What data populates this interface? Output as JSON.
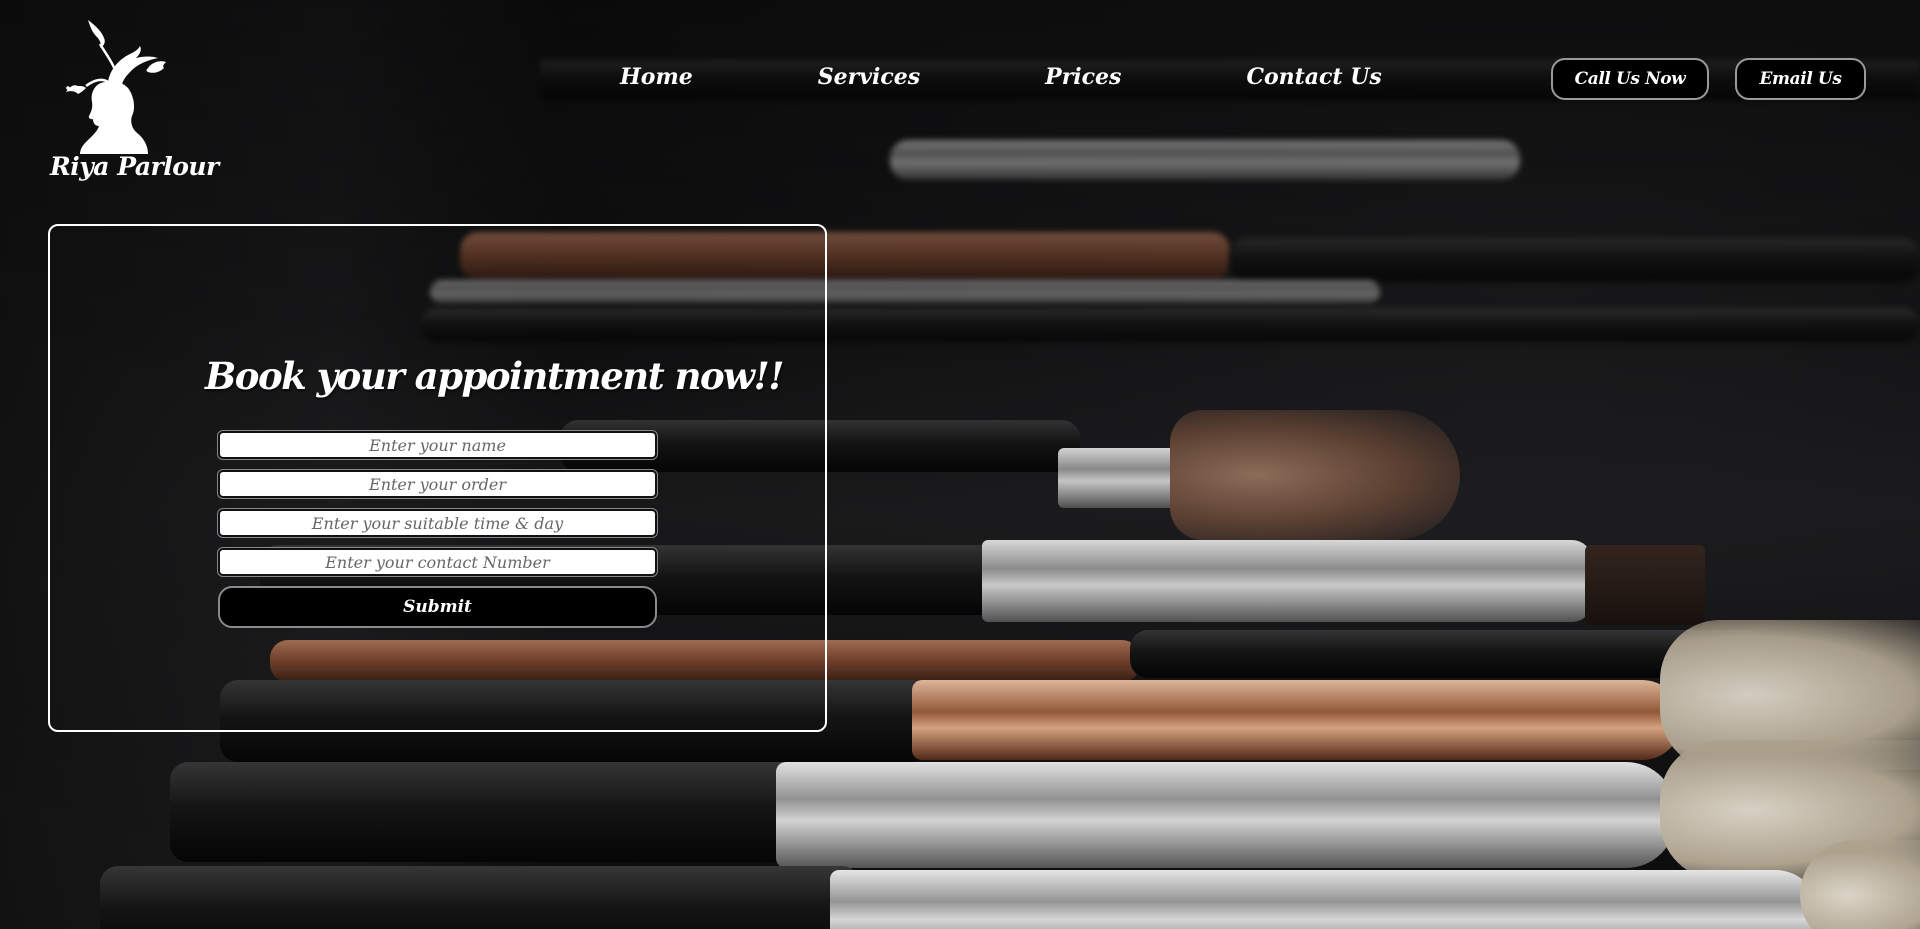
{
  "brand": {
    "name": "Riya Parlour",
    "logo_icon": "woman-silhouette-with-birds-icon"
  },
  "nav": {
    "home": "Home",
    "services": "Services",
    "prices": "Prices",
    "contact": "Contact Us"
  },
  "actions": {
    "call": "Call Us Now",
    "email": "Email Us"
  },
  "booking": {
    "title": "Book your appointment now!!",
    "name_placeholder": "Enter your name",
    "order_placeholder": "Enter your order",
    "time_placeholder": "Enter your suitable time & day",
    "contact_placeholder": "Enter your contact Number",
    "submit": "Submit"
  },
  "colors": {
    "text": "#ffffff",
    "button_bg": "#000000",
    "button_border": "#9a9a9a"
  }
}
